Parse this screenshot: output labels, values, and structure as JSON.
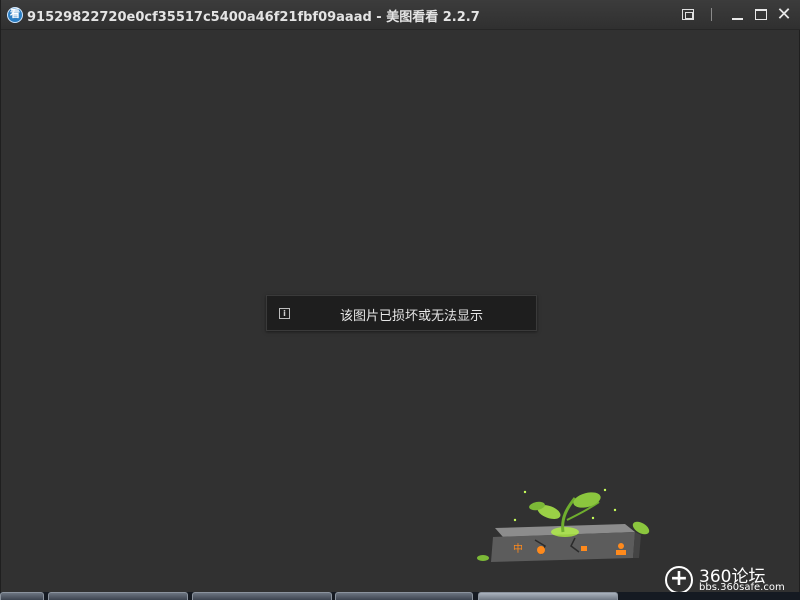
{
  "window": {
    "title": "91529822720e0cf35517c5400a46f21fbf09aaad - 美图看看 2.2.7",
    "app_icon_glyph": "看",
    "controls": {
      "fit_icon": "fit-to-window-icon",
      "minimize_icon": "minimize-icon",
      "maximize_icon": "maximize-icon",
      "close_glyph": "✕"
    }
  },
  "viewer": {
    "error_message": "该图片已损坏或无法显示",
    "info_glyph": "i"
  },
  "watermark": {
    "badge_glyph": "+",
    "title": "360论坛",
    "url": "bbs.360safe.com"
  },
  "colors": {
    "background": "#313131",
    "titlebar": "#363636",
    "toast": "#1e1e1e",
    "text": "#e6e6e6",
    "plant_green": "#8bc63e"
  }
}
